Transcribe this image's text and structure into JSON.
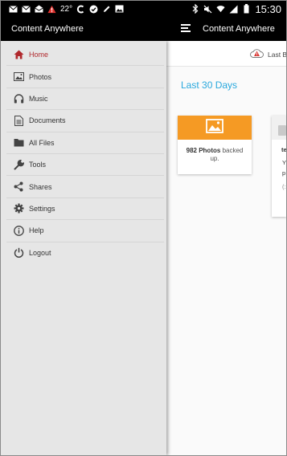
{
  "status_bar": {
    "temperature": "22°",
    "time": "15:30",
    "left_icons": [
      "mail-icon",
      "mail-icon",
      "mail-open-icon",
      "warning-icon",
      "thermometer",
      "c-logo-icon",
      "check-icon",
      "pencil-icon",
      "image-icon"
    ],
    "right_icons": [
      "bluetooth-icon",
      "mute-icon",
      "wifi-icon",
      "signal-icon",
      "battery-icon"
    ]
  },
  "app_bar": {
    "drawer_title": "Content Anywhere",
    "title": "Content Anywhere",
    "menu_icon": "hamburger-icon"
  },
  "nav": {
    "items": [
      {
        "label": "Home",
        "icon": "home-icon",
        "active": true
      },
      {
        "label": "Photos",
        "icon": "photos-icon",
        "active": false
      },
      {
        "label": "Music",
        "icon": "headphones-icon",
        "active": false
      },
      {
        "label": "Documents",
        "icon": "document-icon",
        "active": false
      },
      {
        "label": "All Files",
        "icon": "folder-icon",
        "active": false
      },
      {
        "label": "Tools",
        "icon": "wrench-icon",
        "active": false
      },
      {
        "label": "Shares",
        "icon": "share-icon",
        "active": false
      },
      {
        "label": "Settings",
        "icon": "gear-icon",
        "active": false
      },
      {
        "label": "Help",
        "icon": "info-icon",
        "active": false
      },
      {
        "label": "Logout",
        "icon": "power-icon",
        "active": false
      }
    ]
  },
  "main": {
    "banner_text": "Last B",
    "section_title": "Last 30 Days",
    "photos_card": {
      "count": "982 Photos",
      "suffix": "backed up."
    },
    "partial_card_lines": [
      "te",
      "Y",
      "p",
      "(:"
    ]
  },
  "colors": {
    "active": "#b0282c",
    "accent_blue": "#29a8dd",
    "photos_orange": "#f59a24"
  }
}
